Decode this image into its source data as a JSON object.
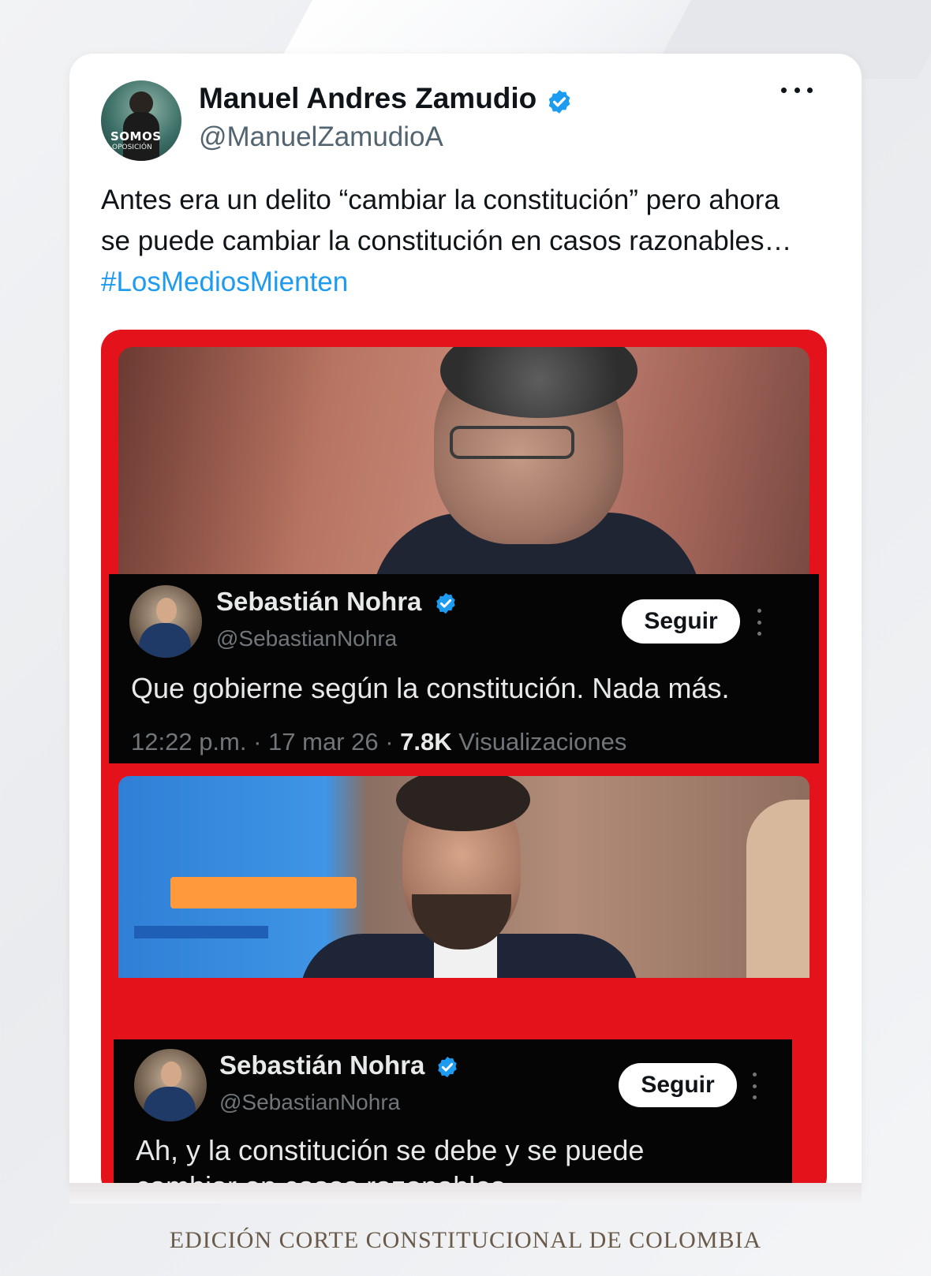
{
  "post": {
    "author_name": "Manuel Andres Zamudio",
    "author_handle": "@ManuelZamudioA",
    "avatar_text_1": "SOMOS",
    "avatar_text_2": "OPOSICIÓN",
    "text_before_hashtag": "Antes era un delito “cambiar la constitución” pero ahora se puede cambiar la constitución en casos razonables… ",
    "hashtag": "#LosMediosMienten",
    "verified_color": "#1d9bf0",
    "icons": [
      "verified-badge-icon",
      "more-options-icon"
    ]
  },
  "embedded": {
    "frame_color": "#e3121b",
    "tweet1": {
      "name": "Sebastián Nohra",
      "handle": "@SebastianNohra",
      "follow_label": "Seguir",
      "text": "Que gobierne según la constitución. Nada más.",
      "time": "12:22 p.m. · 17 mar 26 · ",
      "views_count": "7.8K",
      "views_label": " Visualizaciones"
    },
    "tweet2": {
      "name": "Sebastián Nohra",
      "handle": "@SebastianNohra",
      "follow_label": "Seguir",
      "text_line1": "Ah, y la constitución se debe y se puede",
      "text_line2": "cambiar en casos razonables."
    }
  },
  "caption": "EDICIÓN CORTE CONSTITUCIONAL DE COLOMBIA"
}
